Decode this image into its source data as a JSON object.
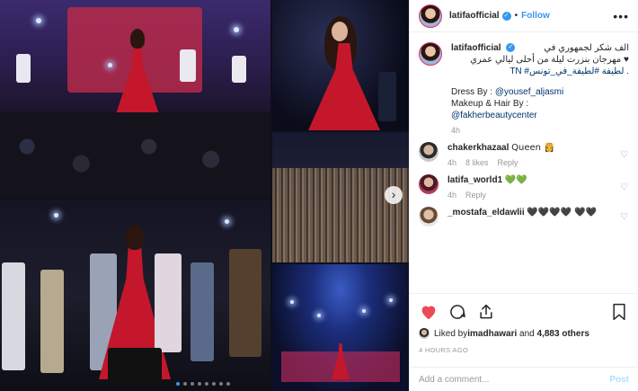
{
  "post": {
    "username": "latifaofficial",
    "follow_label": "Follow",
    "dot": "•",
    "more_label": "•••",
    "verified_mark": "✓"
  },
  "caption": {
    "username": "latifaofficial",
    "line1": "الف شكر لجمهوري في",
    "line2": "♥ مهرجان بنزرت ليلة من أحلى ليالي عمري",
    "line3": ". لطيفة #لطيفة_في_تونس# TN",
    "dress": "Dress By : ",
    "dress_handle": "@yousef_aljasmi",
    "makeup": "Makeup & Hair By :",
    "makeup_handle": "@fakherbeautycenter",
    "time": "4h"
  },
  "comments": [
    {
      "user": "chakerkhazaal",
      "text": "Queen 👸",
      "time": "4h",
      "likes": "8 likes",
      "reply": "Reply"
    },
    {
      "user": "latifa_world1",
      "text": "💚💚",
      "time": "4h",
      "reply": "Reply"
    },
    {
      "user": "_mostafa_eldawlii",
      "text": "🖤🖤🖤🖤 🖤🖤"
    }
  ],
  "likes": {
    "prefix": "Liked by ",
    "user": "imadhawari",
    "middle": " and ",
    "count": "4,883 others"
  },
  "timestamp": "4 HOURS AGO",
  "add_comment": {
    "placeholder": "Add a comment...",
    "post_label": "Post"
  },
  "carousel": {
    "next_label": "›",
    "slides": 8,
    "active_slide": 1
  },
  "colors": {
    "accent": "#3897f0",
    "link": "#003569",
    "like_red": "#ed4956",
    "post_disabled": "#b2dffc"
  },
  "icons": [
    "heart-icon",
    "comment-icon",
    "share-icon",
    "bookmark-icon",
    "verified-icon",
    "more-icon",
    "heart-outline-icon",
    "chevron-right-icon"
  ]
}
